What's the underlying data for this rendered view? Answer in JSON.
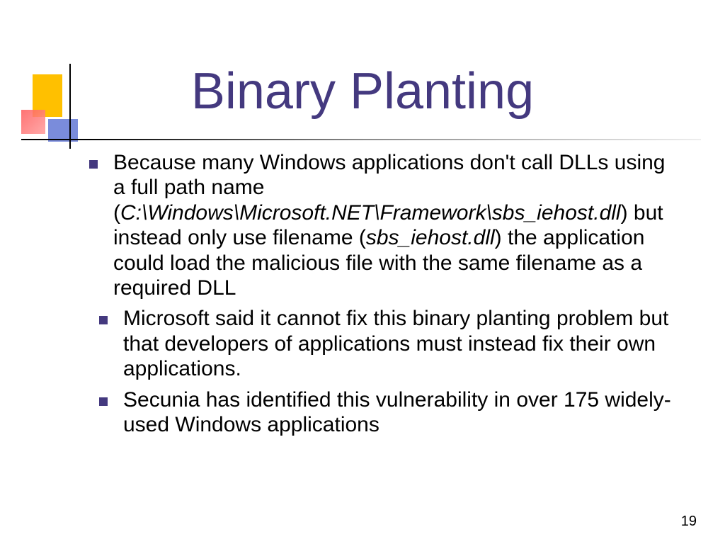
{
  "slide": {
    "title": "Binary Planting",
    "page_number": "19",
    "bullets": [
      {
        "pre": "Because many Windows applications don't call DLLs using a full path name (",
        "em1": "C:\\Windows\\Microsoft.NET\\Framework\\sbs_iehost.dll",
        "mid": ") but instead only use filename (",
        "em2": "sbs_iehost.dll",
        "post": ") the application could load the malicious file with the same filename as a required DLL"
      },
      {
        "text": "Microsoft said it cannot fix this binary planting problem but that developers of applications must instead fix their own applications."
      },
      {
        "text": "Secunia has identified this vulnerability in over 175 widely-used Windows applications"
      }
    ]
  }
}
